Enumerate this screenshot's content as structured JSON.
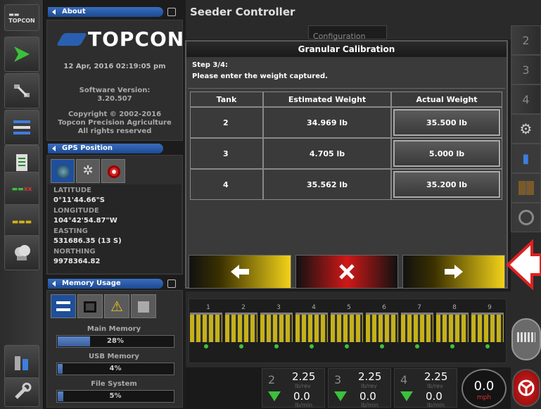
{
  "header": {
    "title": "Seeder Controller",
    "config_tab": "Configuration"
  },
  "about": {
    "title": "About",
    "logo": "TOPCON",
    "datetime": "12 Apr, 2016  02:19:05 pm",
    "version_label": "Software Version:",
    "version": "3.20.507",
    "copyright1": "Copyright © 2002-2016",
    "copyright2": "Topcon Precision Agriculture",
    "copyright3": "All rights reserved"
  },
  "gps": {
    "title": "GPS Position",
    "rows": [
      {
        "label": "LATITUDE",
        "value": "0°11'44.66\"S"
      },
      {
        "label": "LONGITUDE",
        "value": "104°42'54.87\"W"
      },
      {
        "label": "EASTING",
        "value": "531686.35 (13 S)"
      },
      {
        "label": "NORTHING",
        "value": "9978364.82"
      }
    ]
  },
  "memory": {
    "title": "Memory Usage",
    "items": [
      {
        "label": "Main Memory",
        "value": "28%",
        "fraction": 0.28
      },
      {
        "label": "USB Memory",
        "value": "4%",
        "fraction": 0.04
      },
      {
        "label": "File System",
        "value": "5%",
        "fraction": 0.05
      }
    ]
  },
  "dialog": {
    "title": "Granular Calibration",
    "step": "Step 3/4:",
    "instruction": "Please enter the weight captured.",
    "headers": [
      "Tank",
      "Estimated Weight",
      "Actual Weight"
    ],
    "rows": [
      {
        "tank": "2",
        "estimated": "34.969 lb",
        "actual": "35.500 lb"
      },
      {
        "tank": "3",
        "estimated": "4.705 lb",
        "actual": "5.000 lb"
      },
      {
        "tank": "4",
        "estimated": "35.562 lb",
        "actual": "35.200 lb"
      }
    ]
  },
  "right_bar": {
    "tabs": [
      "2",
      "3",
      "4"
    ]
  },
  "sections": [
    "1",
    "2",
    "3",
    "4",
    "5",
    "6",
    "7",
    "8",
    "9"
  ],
  "rates": [
    {
      "tank": "2",
      "rate": "2.25",
      "rate_unit": "lb/rev",
      "flow": "0.0",
      "flow_unit": "lb/min"
    },
    {
      "tank": "3",
      "rate": "2.25",
      "rate_unit": "lb/rev",
      "flow": "0.0",
      "flow_unit": "lb/min"
    },
    {
      "tank": "4",
      "rate": "2.25",
      "rate_unit": "lb/rev",
      "flow": "0.0",
      "flow_unit": "lb/min"
    }
  ],
  "speed": {
    "value": "0.0",
    "unit": "mph"
  },
  "colors": {
    "accent_blue": "#2a5fb0",
    "yellow": "#f2d21a",
    "red": "#d01818"
  }
}
